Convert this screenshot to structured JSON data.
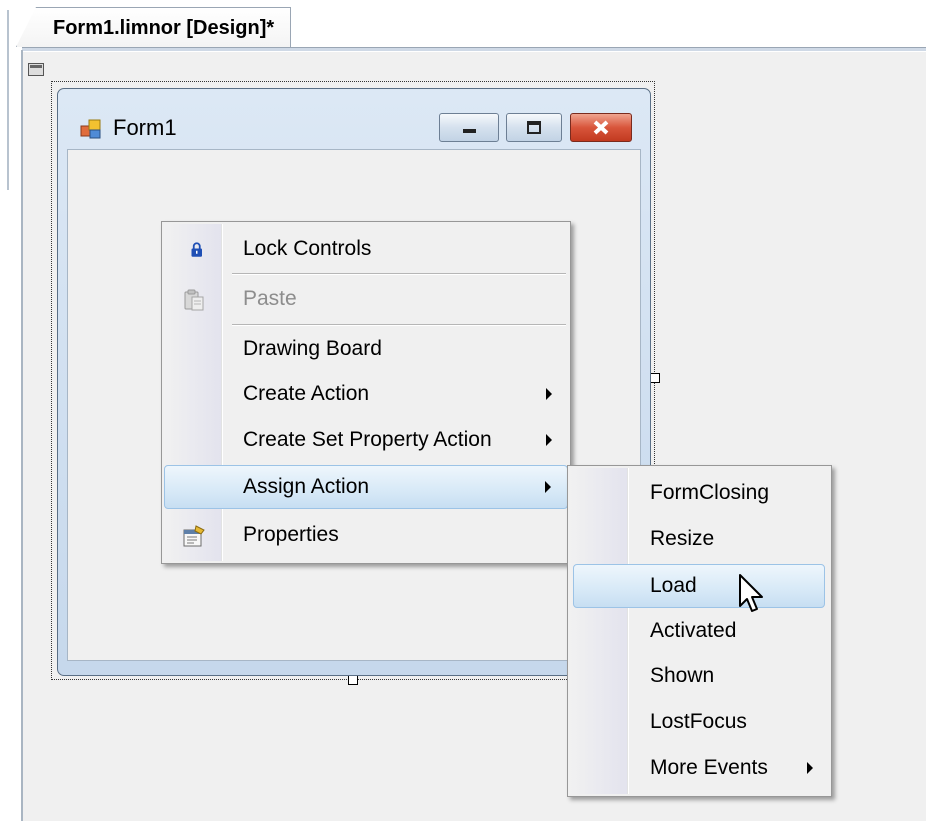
{
  "document_tab": {
    "title": "Form1.limnor [Design]*"
  },
  "form": {
    "title": "Form1"
  },
  "context_menu": {
    "items": [
      {
        "label": "Lock Controls",
        "icon": "lock-icon",
        "disabled": false
      },
      {
        "label": "Paste",
        "icon": "paste-icon",
        "disabled": true
      },
      {
        "label": "Drawing Board"
      },
      {
        "label": "Create Action",
        "has_submenu": true
      },
      {
        "label": "Create Set Property Action",
        "has_submenu": true
      },
      {
        "label": "Assign Action",
        "has_submenu": true,
        "highlighted": true
      },
      {
        "label": "Properties",
        "icon": "properties-icon"
      }
    ]
  },
  "submenu": {
    "items": [
      {
        "label": "FormClosing"
      },
      {
        "label": "Resize"
      },
      {
        "label": "Load",
        "highlighted": true
      },
      {
        "label": "Activated"
      },
      {
        "label": "Shown"
      },
      {
        "label": "LostFocus"
      },
      {
        "label": "More Events",
        "has_submenu": true
      }
    ]
  },
  "colors": {
    "highlight_border": "#9cc3e6",
    "close_button": "#d8553b",
    "lock_icon": "#1f4fb5"
  }
}
